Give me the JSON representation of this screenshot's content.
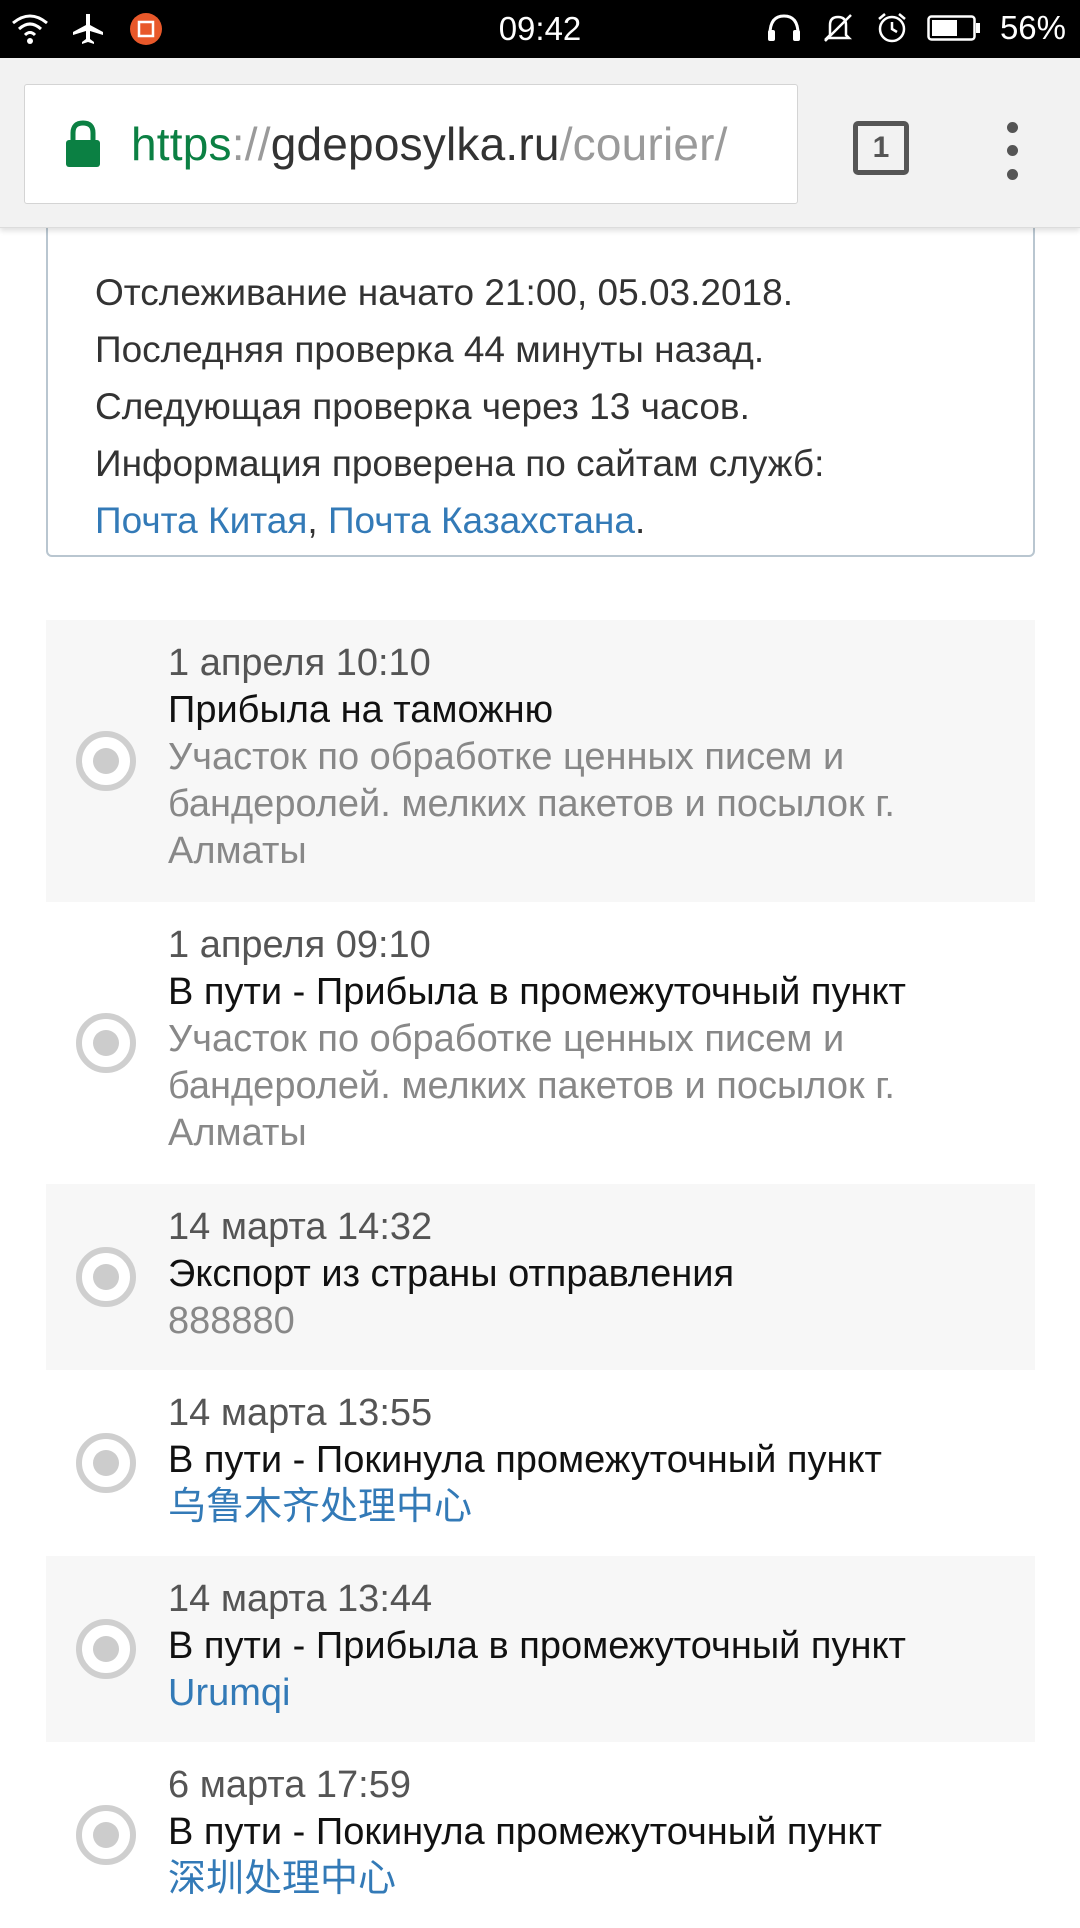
{
  "status_bar": {
    "time": "09:42",
    "battery_percent": "56%",
    "icons_left": [
      "wifi-icon",
      "airplane-icon",
      "app-notification-icon"
    ],
    "icons_right": [
      "headset-icon",
      "notifications-off-icon",
      "alarm-icon",
      "battery-icon"
    ]
  },
  "browser": {
    "url_scheme": "https",
    "url_separator": "://",
    "url_host": "gdeposylka.ru",
    "url_path": "/courier/",
    "tab_count": "1"
  },
  "info": {
    "line1": "Отслеживание начато 21:00, 05.03.2018.",
    "line2": "Последняя проверка 44 минуты назад.",
    "line3": "Следующая проверка через 13 часов.",
    "line4": "Информация проверена по сайтам служб:",
    "link1": "Почта Китая",
    "comma": ",",
    "link2": "Почта Казахстана",
    "period": "."
  },
  "events": [
    {
      "date": "1 апреля 10:10",
      "status": "Прибыла на таможню",
      "place": "Участок по обработке ценных писем и бандеролей. мелких пакетов и посылок г. Алматы",
      "place_is_link": false
    },
    {
      "date": "1 апреля 09:10",
      "status": "В пути - Прибыла в промежуточный пункт",
      "place": "Участок по обработке ценных писем и бандеролей. мелких пакетов и посылок г. Алматы",
      "place_is_link": false
    },
    {
      "date": "14 марта 14:32",
      "status": "Экспорт из страны отправления",
      "place": "888880",
      "place_is_link": false
    },
    {
      "date": "14 марта 13:55",
      "status": "В пути - Покинула промежуточный пункт",
      "place": "乌鲁木齐处理中心",
      "place_is_link": true
    },
    {
      "date": "14 марта 13:44",
      "status": "В пути - Прибыла в промежуточный пункт",
      "place": "Urumqi",
      "place_is_link": true
    },
    {
      "date": "6 марта 17:59",
      "status": "В пути - Покинула промежуточный пункт",
      "place": "深圳处理中心",
      "place_is_link": true
    }
  ]
}
